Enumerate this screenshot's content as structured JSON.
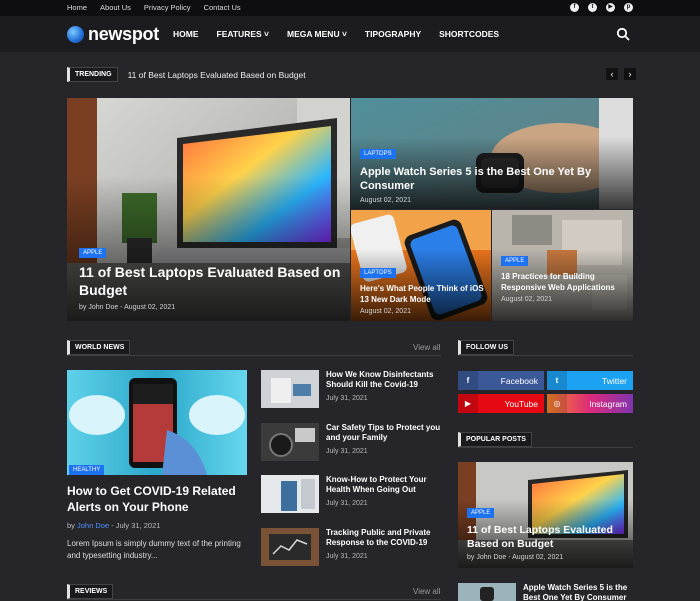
{
  "topbar": {
    "links": [
      "Home",
      "About Us",
      "Privacy Policy",
      "Contact Us"
    ]
  },
  "site": {
    "name": "newspot"
  },
  "menu": [
    "HOME",
    "FEATURES ˅",
    "MEGA MENU ˅",
    "TIPOGRAPHY",
    "SHORTCODES"
  ],
  "trending": {
    "label": "TRENDING",
    "headline": "11 of Best Laptops Evaluated Based on Budget",
    "prev": "‹",
    "next": "›"
  },
  "hero": {
    "main": {
      "badge": "APPLE",
      "title": "11 of Best Laptops Evaluated Based on Budget",
      "meta": "by John Doe - August 02, 2021"
    },
    "top_right": {
      "badge": "LAPTOPS",
      "title": "Apple Watch Series 5 is the Best One Yet By Consumer",
      "meta": "August 02, 2021"
    },
    "bottom_left": {
      "badge": "LAPTOPS",
      "title": "Here's What People Think of iOS 13 New Dark Mode",
      "meta": "August 02, 2021"
    },
    "bottom_right": {
      "badge": "APPLE",
      "title": "18 Practices for Building Responsive Web Applications",
      "meta": "August 02, 2021"
    }
  },
  "world_news": {
    "label": "WORLD NEWS",
    "view_all": "View all",
    "feature": {
      "badge": "HEALTHY",
      "title": "How to Get COVID-19 Related Alerts on Your Phone",
      "by": "by",
      "author": "John Doe",
      "date": "- July 31, 2021",
      "excerpt": "Lorem Ipsum is simply dummy text of the printing and typesetting industry..."
    },
    "items": [
      {
        "title": "How We Know Disinfectants Should Kill the Covid-19",
        "date": "July 31, 2021"
      },
      {
        "title": "Car Safety Tips to Protect you and your Family",
        "date": "July 31, 2021"
      },
      {
        "title": "Know-How to Protect Your Health When Going Out",
        "date": "July 31, 2021"
      },
      {
        "title": "Tracking Public and Private Response to the COVID-19",
        "date": "July 31, 2021"
      }
    ]
  },
  "follow_us": {
    "label": "FOLLOW US",
    "buttons": [
      {
        "label": "Facebook",
        "icon": "f",
        "color": "#3b5998"
      },
      {
        "label": "Twitter",
        "icon": "t",
        "color": "#1da1f2"
      },
      {
        "label": "YouTube",
        "icon": "▶",
        "color": "#e50914"
      },
      {
        "label": "Instagram",
        "icon": "◎",
        "color": "#c13584"
      }
    ]
  },
  "popular_posts": {
    "label": "POPULAR POSTS",
    "feature": {
      "badge": "APPLE",
      "title": "11 of Best Laptops Evaluated Based on Budget",
      "meta": "by John Doe - August 02, 2021"
    },
    "next_title": "Apple Watch Series 5 is the Best One Yet By Consumer"
  },
  "reviews": {
    "label": "REVIEWS",
    "view_all": "View all"
  },
  "colors": {
    "accent": "#1d72f2",
    "background": "#26262a",
    "topbar": "#0e0e10",
    "nav": "#1c1c20"
  }
}
